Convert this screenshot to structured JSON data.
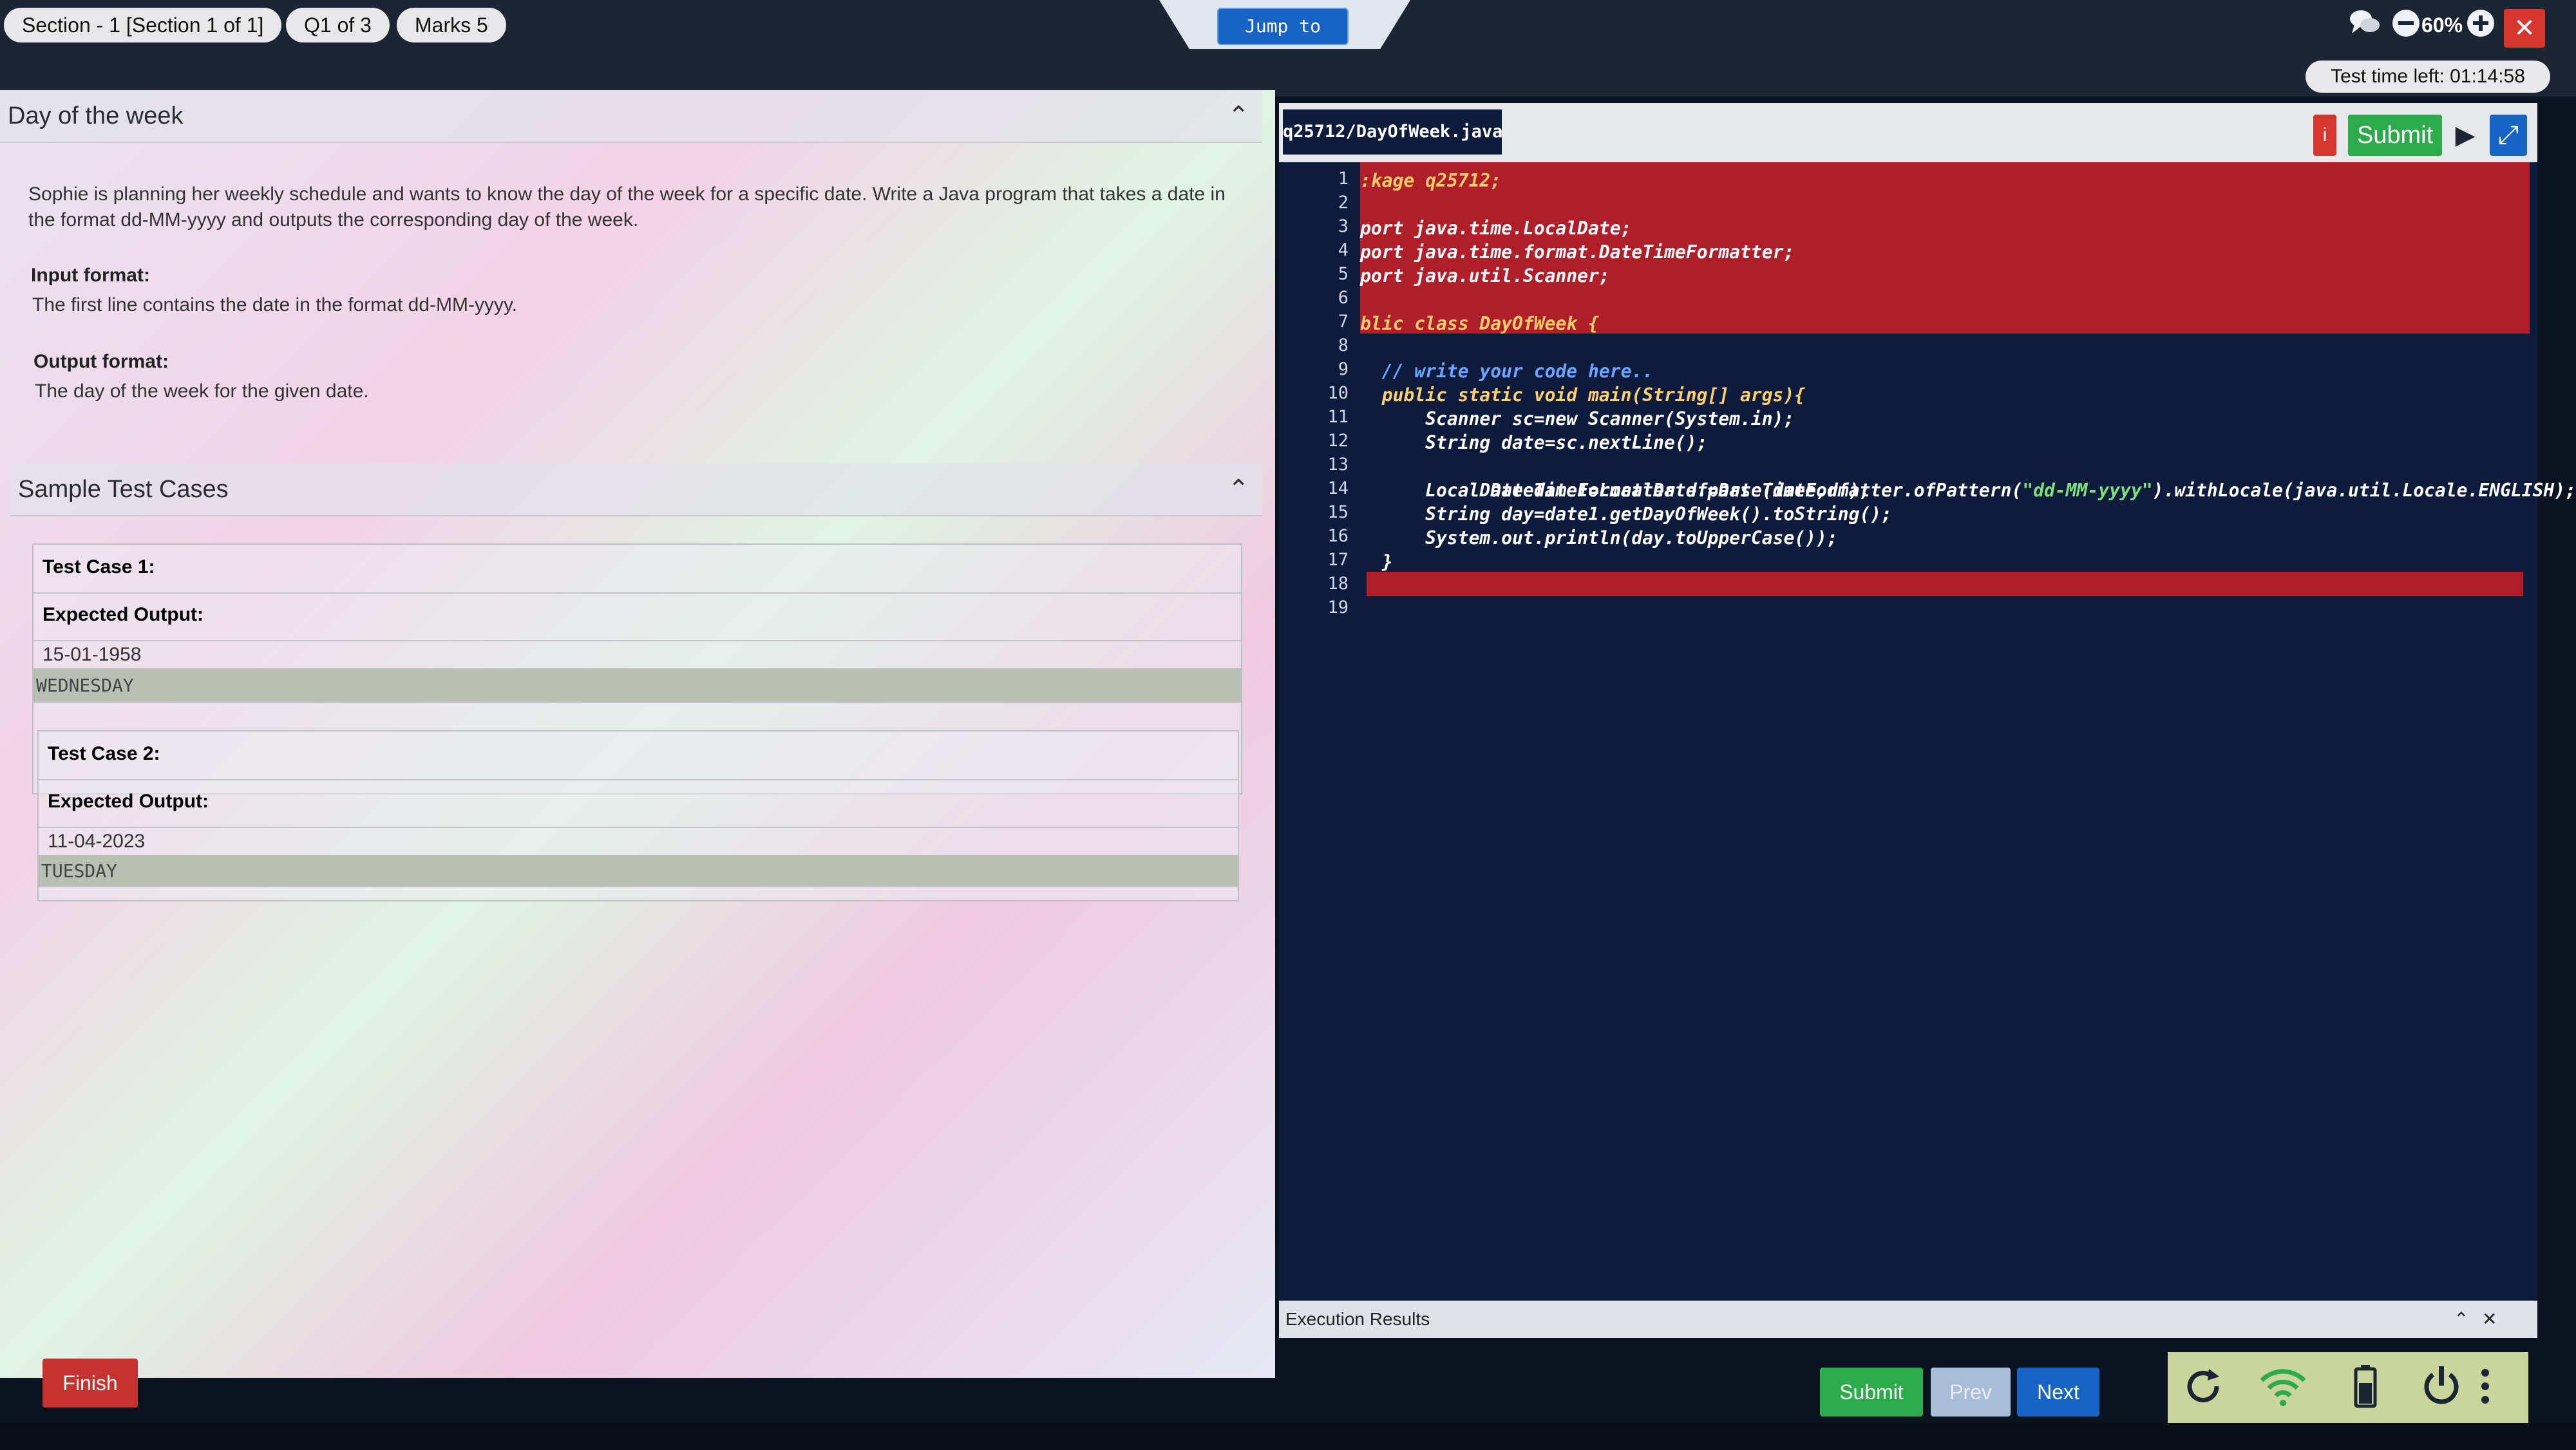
{
  "topbar": {
    "section_label": "Section - 1 [Section 1 of 1]",
    "question_label": "Q1 of 3",
    "marks_label": "Marks 5",
    "jump_label": "Jump to",
    "chat_icon": "chat-bubbles-icon",
    "zoom_out_icon": "zoom-out-icon",
    "zoom_level": "60%",
    "zoom_in_icon": "zoom-in-icon",
    "close_icon": "close-icon",
    "timer": "Test time left: 01:14:58"
  },
  "problem": {
    "title": "Day of the week",
    "description": "Sophie is planning her weekly schedule and wants to know the day of the week for a specific date. Write a Java program that takes a date in the format dd-MM-yyyy and outputs the corresponding day of the week.",
    "input_format_label": "Input format:",
    "input_format_text": "The first line contains the date in the format dd-MM-yyyy.",
    "output_format_label": "Output format:",
    "output_format_text": "The day of the week for the given date."
  },
  "samples": {
    "title": "Sample Test Cases",
    "cases": [
      {
        "label": "Test Case 1:",
        "output_label": "Expected Output:",
        "input": "15-01-1958",
        "output": "WEDNESDAY"
      },
      {
        "label": "Test Case 2:",
        "output_label": "Expected Output:",
        "input": "11-04-2023",
        "output": "TUESDAY"
      }
    ]
  },
  "editor": {
    "file_name": "q25712/DayOfWeek.java",
    "submit_label": "Submit",
    "info_icon": "info-icon",
    "run_icon": "play-icon",
    "expand_icon": "expand-icon",
    "line_numbers": [
      "1",
      "2",
      "3",
      "4",
      "5",
      "6",
      "7",
      "8",
      "9",
      "10",
      "11",
      "12",
      "13",
      "14",
      "15",
      "16",
      "17",
      "18",
      "19"
    ],
    "code": {
      "l1": ":kage q25712;",
      "l3": "port java.time.LocalDate;",
      "l4": "port java.time.format.DateTimeFormatter;",
      "l5": "port java.util.Scanner;",
      "l7": "blic class DayOfWeek {",
      "l9": "  // write your code here..",
      "l10": "  public static void main(String[] args){",
      "l11": "      Scanner sc=new Scanner(System.in);",
      "l12": "      String date=sc.nextLine();",
      "l13a": "      DateTimeFormatter df=DateTimeFormatter.ofPattern(",
      "l13b": "\"dd-MM-yyyy\"",
      "l13c": ").withLocale(java.util.Locale.ENGLISH);",
      "l14": "      LocalDate date1=LocalDate.parse(date,df);",
      "l15": "      String day=date1.getDayOfWeek().toString();",
      "l16": "      System.out.println(day.toUpperCase());",
      "l17": "  }"
    },
    "execution_label": "Execution Results",
    "exec_expand_icon": "chevron-up-icon",
    "exec_close_icon": "close-icon"
  },
  "bottom": {
    "finish_label": "Finish",
    "submit_label": "Submit",
    "prev_label": "Prev",
    "next_label": "Next",
    "refresh_icon": "refresh-icon",
    "wifi_icon": "wifi-icon",
    "battery_icon": "battery-icon",
    "power_icon": "power-icon",
    "menu_icon": "more-vertical-icon"
  },
  "colors": {
    "red_button": "#c8322e",
    "green_button": "#2bab49",
    "blue_button": "#1763c6",
    "editor_bg": "#0d1b3d",
    "error_highlight": "#b01f29"
  }
}
